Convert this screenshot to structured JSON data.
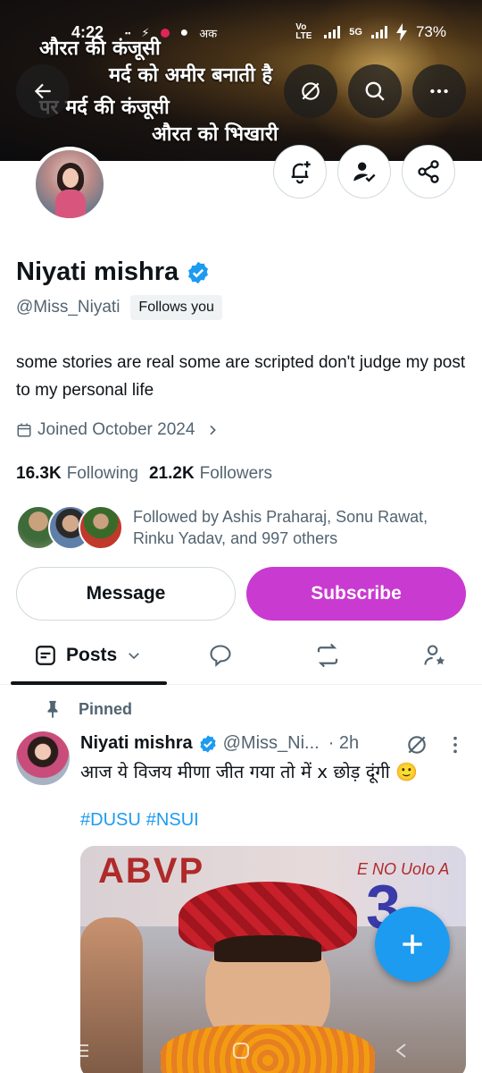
{
  "status_bar": {
    "time": "4:22",
    "battery": "73%",
    "network": "5G",
    "volte": "Vo LTE",
    "left_icons": [
      "data-speed-icon",
      "teams-icon",
      "badge-icon",
      "chat-icon",
      "app-icon"
    ]
  },
  "banner": {
    "line1": "औरत की कंजूसी",
    "line2": "मर्द को अमीर बनाती है",
    "line3": "पर मर्द की कंजूसी",
    "line4": "औरत को भिखारी"
  },
  "profile": {
    "name": "Niyati mishra",
    "handle": "@Miss_Niyati",
    "follows_you": "Follows you",
    "bio": "some stories are real some are scripted don't judge my post to my personal life",
    "joined": "Joined October 2024",
    "following_count": "16.3K",
    "following_label": "Following",
    "followers_count": "21.2K",
    "followers_label": "Followers",
    "followed_by": "Followed by Ashis Praharaj, Sonu Rawat, Rinku Yadav, and 997 others"
  },
  "actions": {
    "message": "Message",
    "subscribe": "Subscribe"
  },
  "tabs": {
    "posts": "Posts"
  },
  "post": {
    "pinned_label": "Pinned",
    "name": "Niyati mishra",
    "handle": "@Miss_Ni...",
    "time": "· 2h",
    "text": "आज ये विजय मीणा जीत गया तो में x छोड़ दूंगी 🙂",
    "hashtag1": "#DUSU",
    "hashtag2": "#NSUI",
    "image_text_left": "ABVP",
    "image_text_right": "E NO UoIo A",
    "image_text_num": "3"
  },
  "colors": {
    "accent": "#1d9bf0",
    "subscribe": "#c93ad1",
    "muted": "#536471",
    "verified": "#1d9bf0"
  }
}
